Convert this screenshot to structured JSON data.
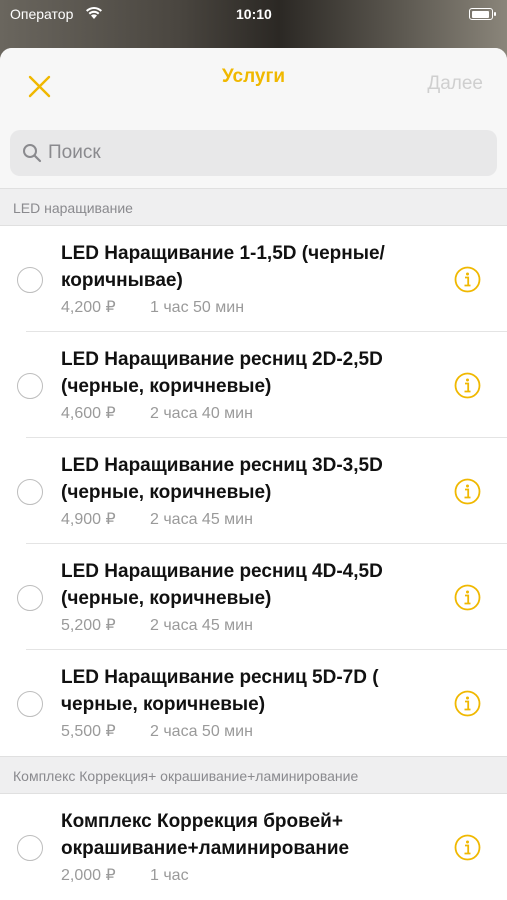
{
  "status_bar": {
    "carrier": "Оператор",
    "time": "10:10"
  },
  "nav": {
    "title": "Услуги",
    "next_label": "Далее",
    "close_icon": "close-icon"
  },
  "search": {
    "placeholder": "Поиск",
    "value": ""
  },
  "colors": {
    "accent": "#f0b800",
    "disabled": "#cfcfcf"
  },
  "sections": [
    {
      "header": "LED наращивание",
      "items": [
        {
          "title": "LED Наращивание 1-1,5D (черные/ коричнывае)",
          "price": "4,200 ₽",
          "duration": "1 час 50 мин"
        },
        {
          "title": "LED Наращивание ресниц 2D-2,5D (черные, коричневые)",
          "price": "4,600 ₽",
          "duration": "2 часа 40 мин"
        },
        {
          "title": "LED Наращивание ресниц 3D-3,5D (черные, коричневые)",
          "price": "4,900 ₽",
          "duration": "2 часа 45 мин"
        },
        {
          "title": "LED Наращивание ресниц 4D-4,5D (черные, коричневые)",
          "price": "5,200 ₽",
          "duration": "2 часа 45 мин"
        },
        {
          "title": "LED Наращивание ресниц 5D-7D ( черные, коричневые)",
          "price": "5,500 ₽",
          "duration": "2 часа 50 мин"
        }
      ]
    },
    {
      "header": "Комплекс Коррекция+ окрашивание+ламинирование",
      "items": [
        {
          "title": "Комплекс Коррекция бровей+ окрашивание+ламинирование",
          "price": "2,000 ₽",
          "duration": "1 час"
        }
      ]
    }
  ]
}
